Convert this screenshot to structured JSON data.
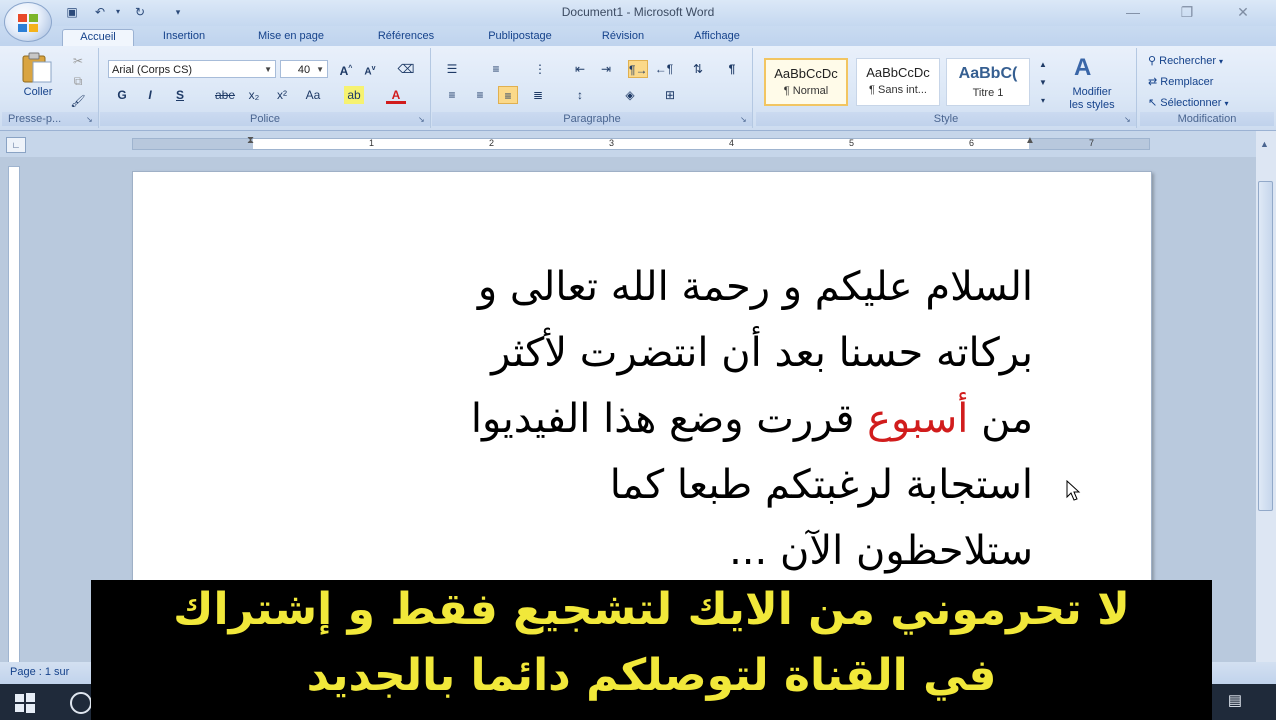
{
  "window": {
    "title": "Document1 - Microsoft Word"
  },
  "ribbon": {
    "tabs": [
      {
        "label": "Accueil"
      },
      {
        "label": "Insertion"
      },
      {
        "label": "Mise en page"
      },
      {
        "label": "Références"
      },
      {
        "label": "Publipostage"
      },
      {
        "label": "Révision"
      },
      {
        "label": "Affichage"
      }
    ],
    "clipboard": {
      "paste_label": "Coller",
      "group_label": "Presse-p..."
    },
    "font": {
      "font_name": "Arial (Corps CS)",
      "font_size": "40",
      "bold": "G",
      "italic": "I",
      "underline": "S",
      "strike": "abe",
      "subscript": "x₂",
      "superscript": "x²",
      "change_case": "Aa",
      "group_label": "Police"
    },
    "paragraph": {
      "group_label": "Paragraphe"
    },
    "styles": {
      "items": [
        {
          "preview": "AaBbCcDc",
          "name": "¶ Normal"
        },
        {
          "preview": "AaBbCcDc",
          "name": "¶ Sans int..."
        },
        {
          "preview": "AaBbC(",
          "name": "Titre 1"
        }
      ],
      "modify_label_1": "Modifier",
      "modify_label_2": "les styles",
      "group_label": "Style"
    },
    "editing": {
      "find": "Rechercher",
      "replace": "Remplacer",
      "select": "Sélectionner",
      "group_label": "Modification"
    }
  },
  "ruler": {
    "numbers": [
      "1",
      "1",
      "2",
      "3",
      "4",
      "5",
      "6",
      "7"
    ]
  },
  "document": {
    "line1": "السلام عليكم و رحمة الله تعالى و",
    "line2": "بركاته حسنا بعد أن انتضرت لأكثر",
    "line3_a": "من ",
    "line3_red": "أسبوع",
    "line3_b": " قررت وضع هذا الفيديوا",
    "line4": "استجابة لرغبتكم طبعا كما",
    "line5": "ستلاحظون الآن ..."
  },
  "status": {
    "page": "Page : 1 sur"
  },
  "subtitle": {
    "line1": "لا تحرموني من الايك لتشجيع فقط و إشتراك",
    "line2": "في القناة لتوصلكم دائما بالجديد"
  },
  "colors": {
    "subtitle_text": "#f1e83a",
    "highlight_word": "#d11c1c",
    "ribbon_bg": "#dbe7f6"
  }
}
